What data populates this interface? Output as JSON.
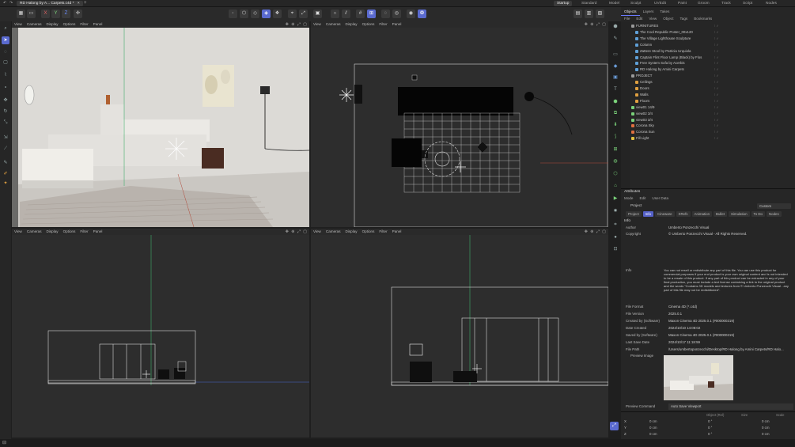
{
  "titlebar": {
    "doc_tab": "RD Halong by A... Carpets.c4d *",
    "close_glyph": "×",
    "plus_glyph": "+",
    "layouts": [
      {
        "label": "Startup",
        "active": true
      },
      {
        "label": "Standard"
      },
      {
        "label": "Model"
      },
      {
        "label": "Sculpt"
      },
      {
        "label": "UVEdit"
      },
      {
        "label": "Paint"
      },
      {
        "label": "Groom"
      },
      {
        "label": "Track"
      },
      {
        "label": "Script"
      },
      {
        "label": "Nodes"
      }
    ]
  },
  "toolbar": {
    "axes": [
      "X",
      "Y",
      "Z"
    ]
  },
  "viewports": {
    "menu": [
      "View",
      "Cameras",
      "Display",
      "Options",
      "Filter",
      "Panel"
    ]
  },
  "objects_panel": {
    "tabs": [
      "Objects",
      "Layers",
      "Takes"
    ],
    "menu": [
      "File",
      "Edit",
      "View",
      "Object",
      "Tags",
      "Bookmarks"
    ],
    "items": [
      {
        "name": "FURNITURES",
        "indent": 0,
        "color": "#9a9a9a"
      },
      {
        "name": "The Cool Republic Poster_00x120",
        "indent": 1,
        "color": "#5fa0d8"
      },
      {
        "name": "The Village Lighthouse Sculpture",
        "indent": 1,
        "color": "#5fa0d8"
      },
      {
        "name": "Column",
        "indent": 1,
        "color": "#5fa0d8"
      },
      {
        "name": "Zattere Stool by Patricia Urquiola",
        "indent": 1,
        "color": "#5fa0d8"
      },
      {
        "name": "Captain Flint Floor Lamp (Black) by Flos",
        "indent": 1,
        "color": "#5fa0d8"
      },
      {
        "name": "Free System Sofa by Acerbis",
        "indent": 1,
        "color": "#5fa0d8"
      },
      {
        "name": "RD Halong by Amini Carpets",
        "indent": 1,
        "color": "#5fa0d8"
      },
      {
        "name": "PROJECT",
        "indent": 0,
        "color": "#9a9a9a"
      },
      {
        "name": "Ceilings",
        "indent": 1,
        "color": "#e0a040"
      },
      {
        "name": "Doors",
        "indent": 1,
        "color": "#e0a040"
      },
      {
        "name": "Walls",
        "indent": 1,
        "color": "#e0a040"
      },
      {
        "name": "Floors",
        "indent": 1,
        "color": "#e0a040"
      },
      {
        "name": "view01 14/9",
        "indent": 0,
        "color": "#7ad27a"
      },
      {
        "name": "view02 3/4",
        "indent": 0,
        "color": "#7ad27a"
      },
      {
        "name": "view03 3/4",
        "indent": 0,
        "color": "#7ad27a"
      },
      {
        "name": "Corona Sky",
        "indent": 0,
        "color": "#e07040"
      },
      {
        "name": "Corona Sun",
        "indent": 0,
        "color": "#e07040"
      },
      {
        "name": "Fill Light",
        "indent": 0,
        "color": "#e0c040"
      }
    ]
  },
  "attributes": {
    "title": "Attributes",
    "menu": [
      "Mode",
      "Edit",
      "User Data"
    ],
    "object_label": "Project",
    "preset": "Custom",
    "subtabs": [
      {
        "label": "Project"
      },
      {
        "label": "Info",
        "active": true
      },
      {
        "label": "Cineware"
      },
      {
        "label": "XRefs"
      },
      {
        "label": "Animation"
      },
      {
        "label": "Bullet"
      },
      {
        "label": "Simulation"
      },
      {
        "label": "To Do"
      },
      {
        "label": "Nodes"
      }
    ],
    "section": "Info",
    "author_label": "Author",
    "author": "Umberto Ponzecchi Visual",
    "copyright_label": "Copyright",
    "copyright": "© Umberto Ponzecchi Visual - All Rights Reserved.",
    "info_label": "Info",
    "info_text": "You can not resell or redistribute any part of this file. You can use this product for commercial purposes if your end product is your own original content and is not intended to be a resale of this product. If any part of this product can be extracted in any of your final production, you must include a text license containing a link to the original product and the words \"Contains 3D models and textures from © Umberto Ponzecchi Visual - any part of this file may not be redistributed\".",
    "rows": [
      {
        "k": "File Format",
        "v": "Cinema 4D (*.c4d)"
      },
      {
        "k": "File Version",
        "v": "2025.0.1"
      },
      {
        "k": "Created by (Software)",
        "v": "Maxon Cinema 4D 2025.0.1 (#000000219)"
      },
      {
        "k": "Date Created",
        "v": "2024/10/10 14:08:02"
      },
      {
        "k": "Saved by (Software)",
        "v": "Maxon Cinema 4D 2025.0.1 (#000000219)"
      },
      {
        "k": "Last Save Date",
        "v": "2024/10/17 11:18:59"
      },
      {
        "k": "File Path",
        "v": "/Users/umbertoponzecchi/Desktop/RD Halong by Amini Carpets/RD Halo..."
      }
    ],
    "preview_label": "Preview Image",
    "preview_command_label": "Preview Command",
    "preview_command": "Auto Save Viewport"
  },
  "coords": {
    "headers": [
      "Object (Rel)",
      "Size",
      "Scale"
    ],
    "rows": [
      {
        "axis": "X",
        "a": "0 cm",
        "b": "0 °",
        "c": "0 cm"
      },
      {
        "axis": "Y",
        "a": "0 cm",
        "b": "0 °",
        "c": "0 cm"
      },
      {
        "axis": "Z",
        "a": "0 cm",
        "b": "0 °",
        "c": "0 cm"
      }
    ]
  },
  "colors": {
    "accent": "#5a6acf",
    "guide_green": "#3fae6a",
    "guide_blue": "#4a6bd4"
  }
}
